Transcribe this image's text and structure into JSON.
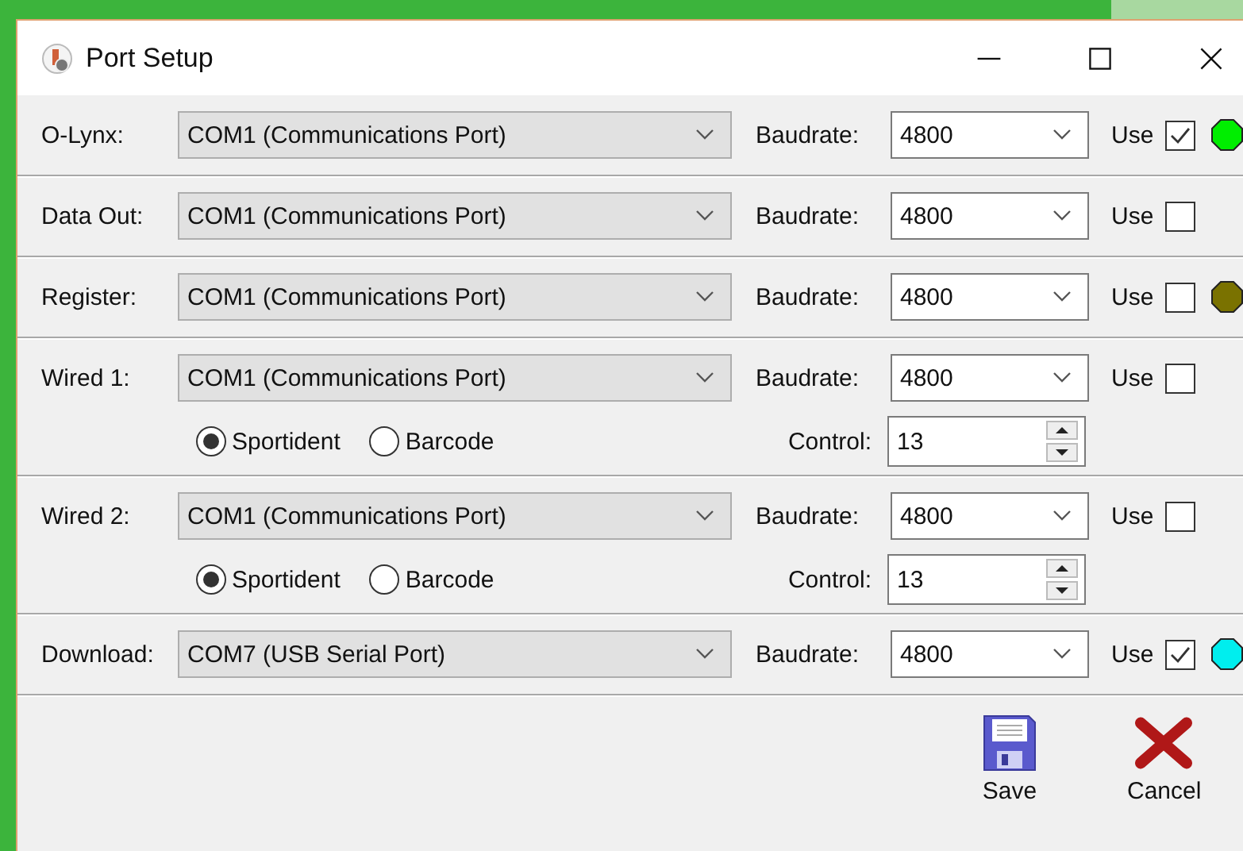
{
  "window": {
    "title": "Port Setup"
  },
  "ports": [
    {
      "kind": "simple",
      "label": "O-Lynx:",
      "port": "COM1 (Communications Port)",
      "baudrate_label": "Baudrate:",
      "baudrate": "4800",
      "use_label": "Use",
      "use": true,
      "color": "#00ee00"
    },
    {
      "kind": "simple",
      "label": "Data Out:",
      "port": "COM1 (Communications Port)",
      "baudrate_label": "Baudrate:",
      "baudrate": "4800",
      "use_label": "Use",
      "use": false
    },
    {
      "kind": "simple",
      "label": "Register:",
      "port": "COM1 (Communications Port)",
      "baudrate_label": "Baudrate:",
      "baudrate": "4800",
      "use_label": "Use",
      "use": false,
      "color": "#7a7200"
    },
    {
      "kind": "wired",
      "label": "Wired 1:",
      "port": "COM1 (Communications Port)",
      "baudrate_label": "Baudrate:",
      "baudrate": "4800",
      "use_label": "Use",
      "use": false,
      "modes": [
        {
          "label": "Sportident",
          "selected": true
        },
        {
          "label": "Barcode",
          "selected": false
        }
      ],
      "control_label": "Control:",
      "control": "13"
    },
    {
      "kind": "wired",
      "label": "Wired 2:",
      "port": "COM1 (Communications Port)",
      "baudrate_label": "Baudrate:",
      "baudrate": "4800",
      "use_label": "Use",
      "use": false,
      "modes": [
        {
          "label": "Sportident",
          "selected": true
        },
        {
          "label": "Barcode",
          "selected": false
        }
      ],
      "control_label": "Control:",
      "control": "13"
    },
    {
      "kind": "simple",
      "label": "Download:",
      "port": "COM7 (USB Serial Port)",
      "baudrate_label": "Baudrate:",
      "baudrate": "4800",
      "use_label": "Use",
      "use": true,
      "color": "#00eeee"
    }
  ],
  "buttons": [
    {
      "kind": "save",
      "label": "Save"
    },
    {
      "kind": "cancel",
      "label": "Cancel"
    }
  ]
}
